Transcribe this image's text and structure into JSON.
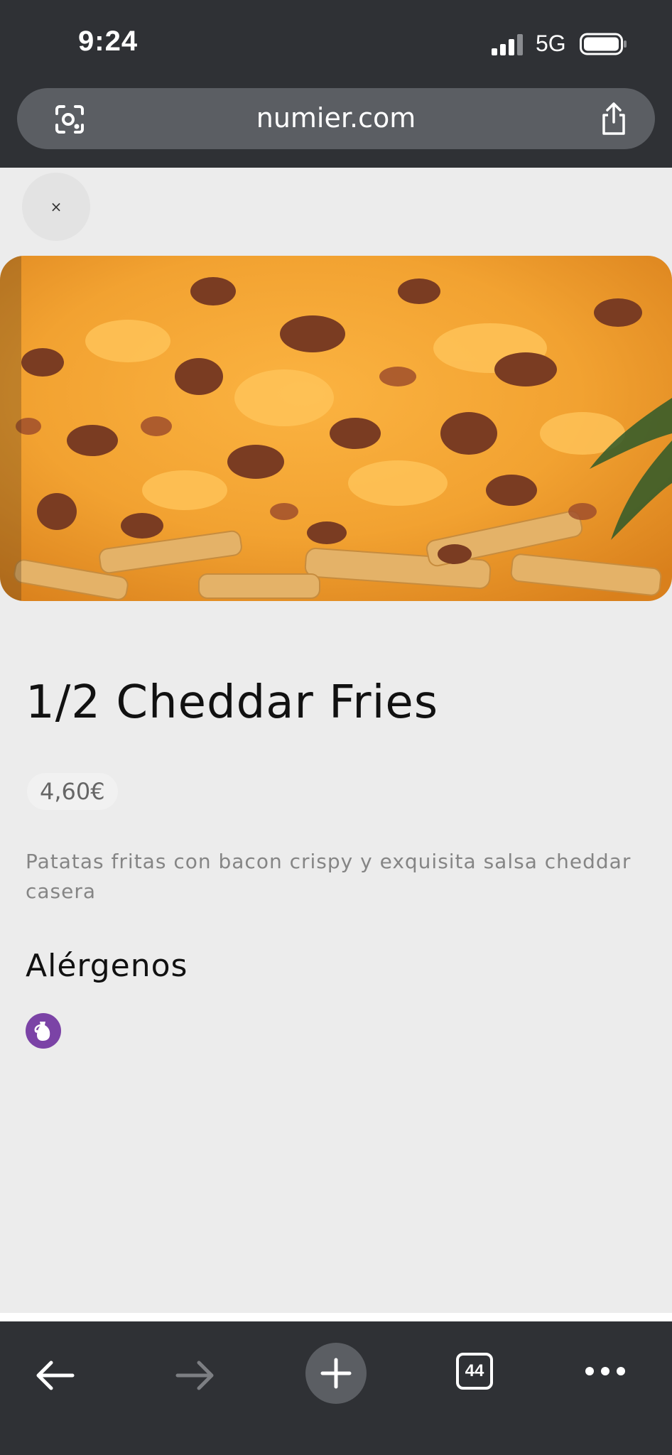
{
  "status_bar": {
    "time": "9:24",
    "network": "5G"
  },
  "browser": {
    "url": "numier.com",
    "tabs_count": "44"
  },
  "item": {
    "close_label": "×",
    "title": "1/2 Cheddar Fries",
    "price": "4,60€",
    "description": "Patatas fritas con bacon crispy y exquisita salsa cheddar casera",
    "allergens_heading": "Alérgenos",
    "allergens": [
      {
        "icon": "milk-jug-icon",
        "color": "#7b43a6"
      }
    ]
  },
  "colors": {
    "chrome": "#2f3135",
    "page_bg": "#ececec",
    "allergen": "#7b43a6"
  }
}
